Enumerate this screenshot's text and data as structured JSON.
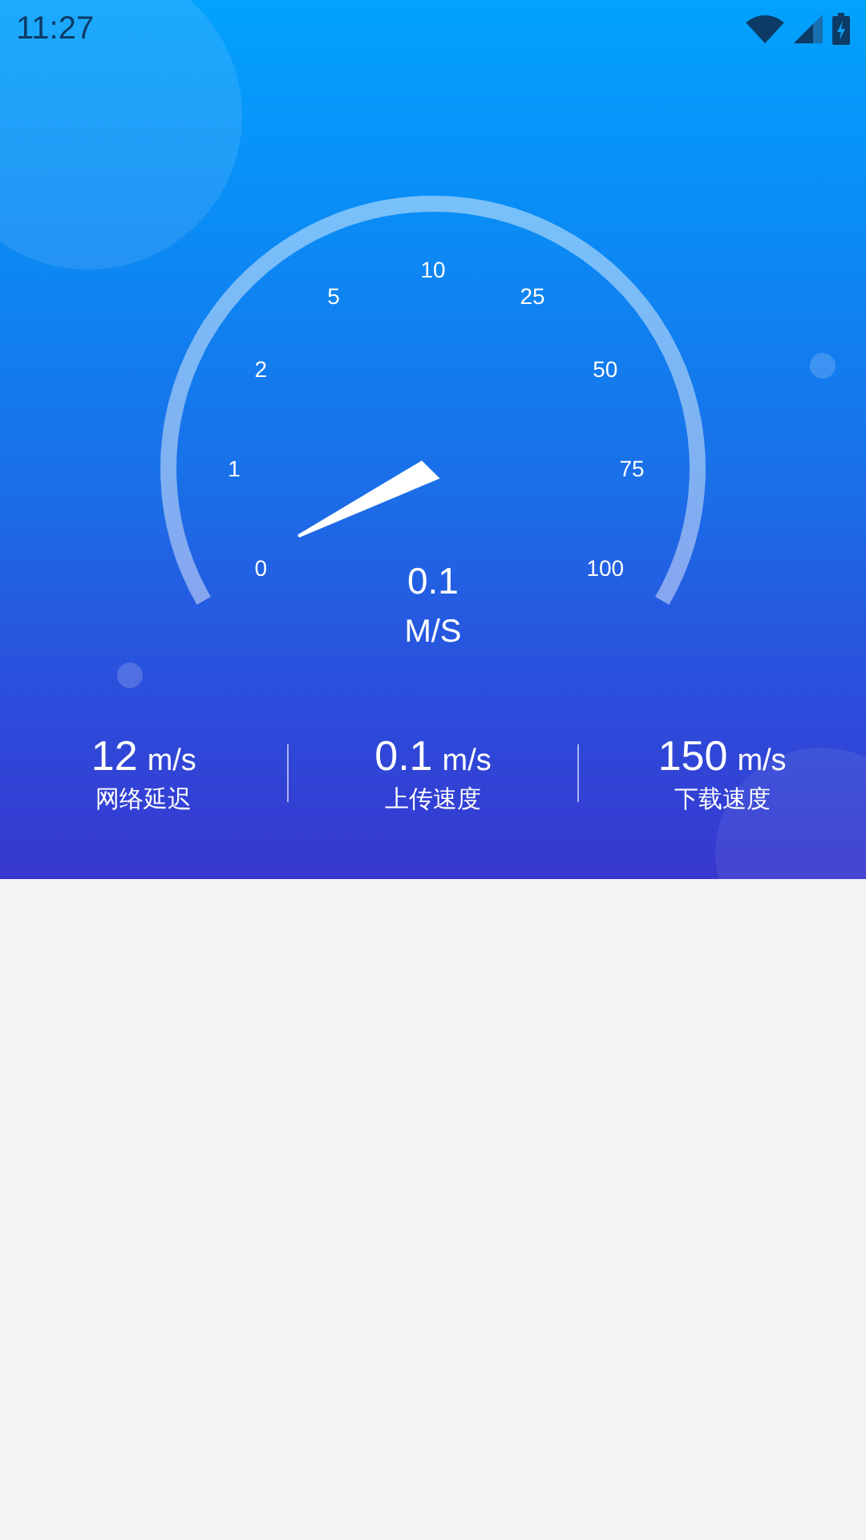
{
  "status_bar": {
    "time": "11:27"
  },
  "gauge": {
    "ticks": [
      "0",
      "1",
      "2",
      "5",
      "10",
      "25",
      "50",
      "75",
      "100"
    ],
    "reading": "0.1",
    "unit": "M/S"
  },
  "stats": [
    {
      "value": "12",
      "unit": "m/s",
      "label": "网络延迟"
    },
    {
      "value": "0.1",
      "unit": "m/s",
      "label": "上传速度"
    },
    {
      "value": "150",
      "unit": "m/s",
      "label": "下载速度"
    }
  ]
}
